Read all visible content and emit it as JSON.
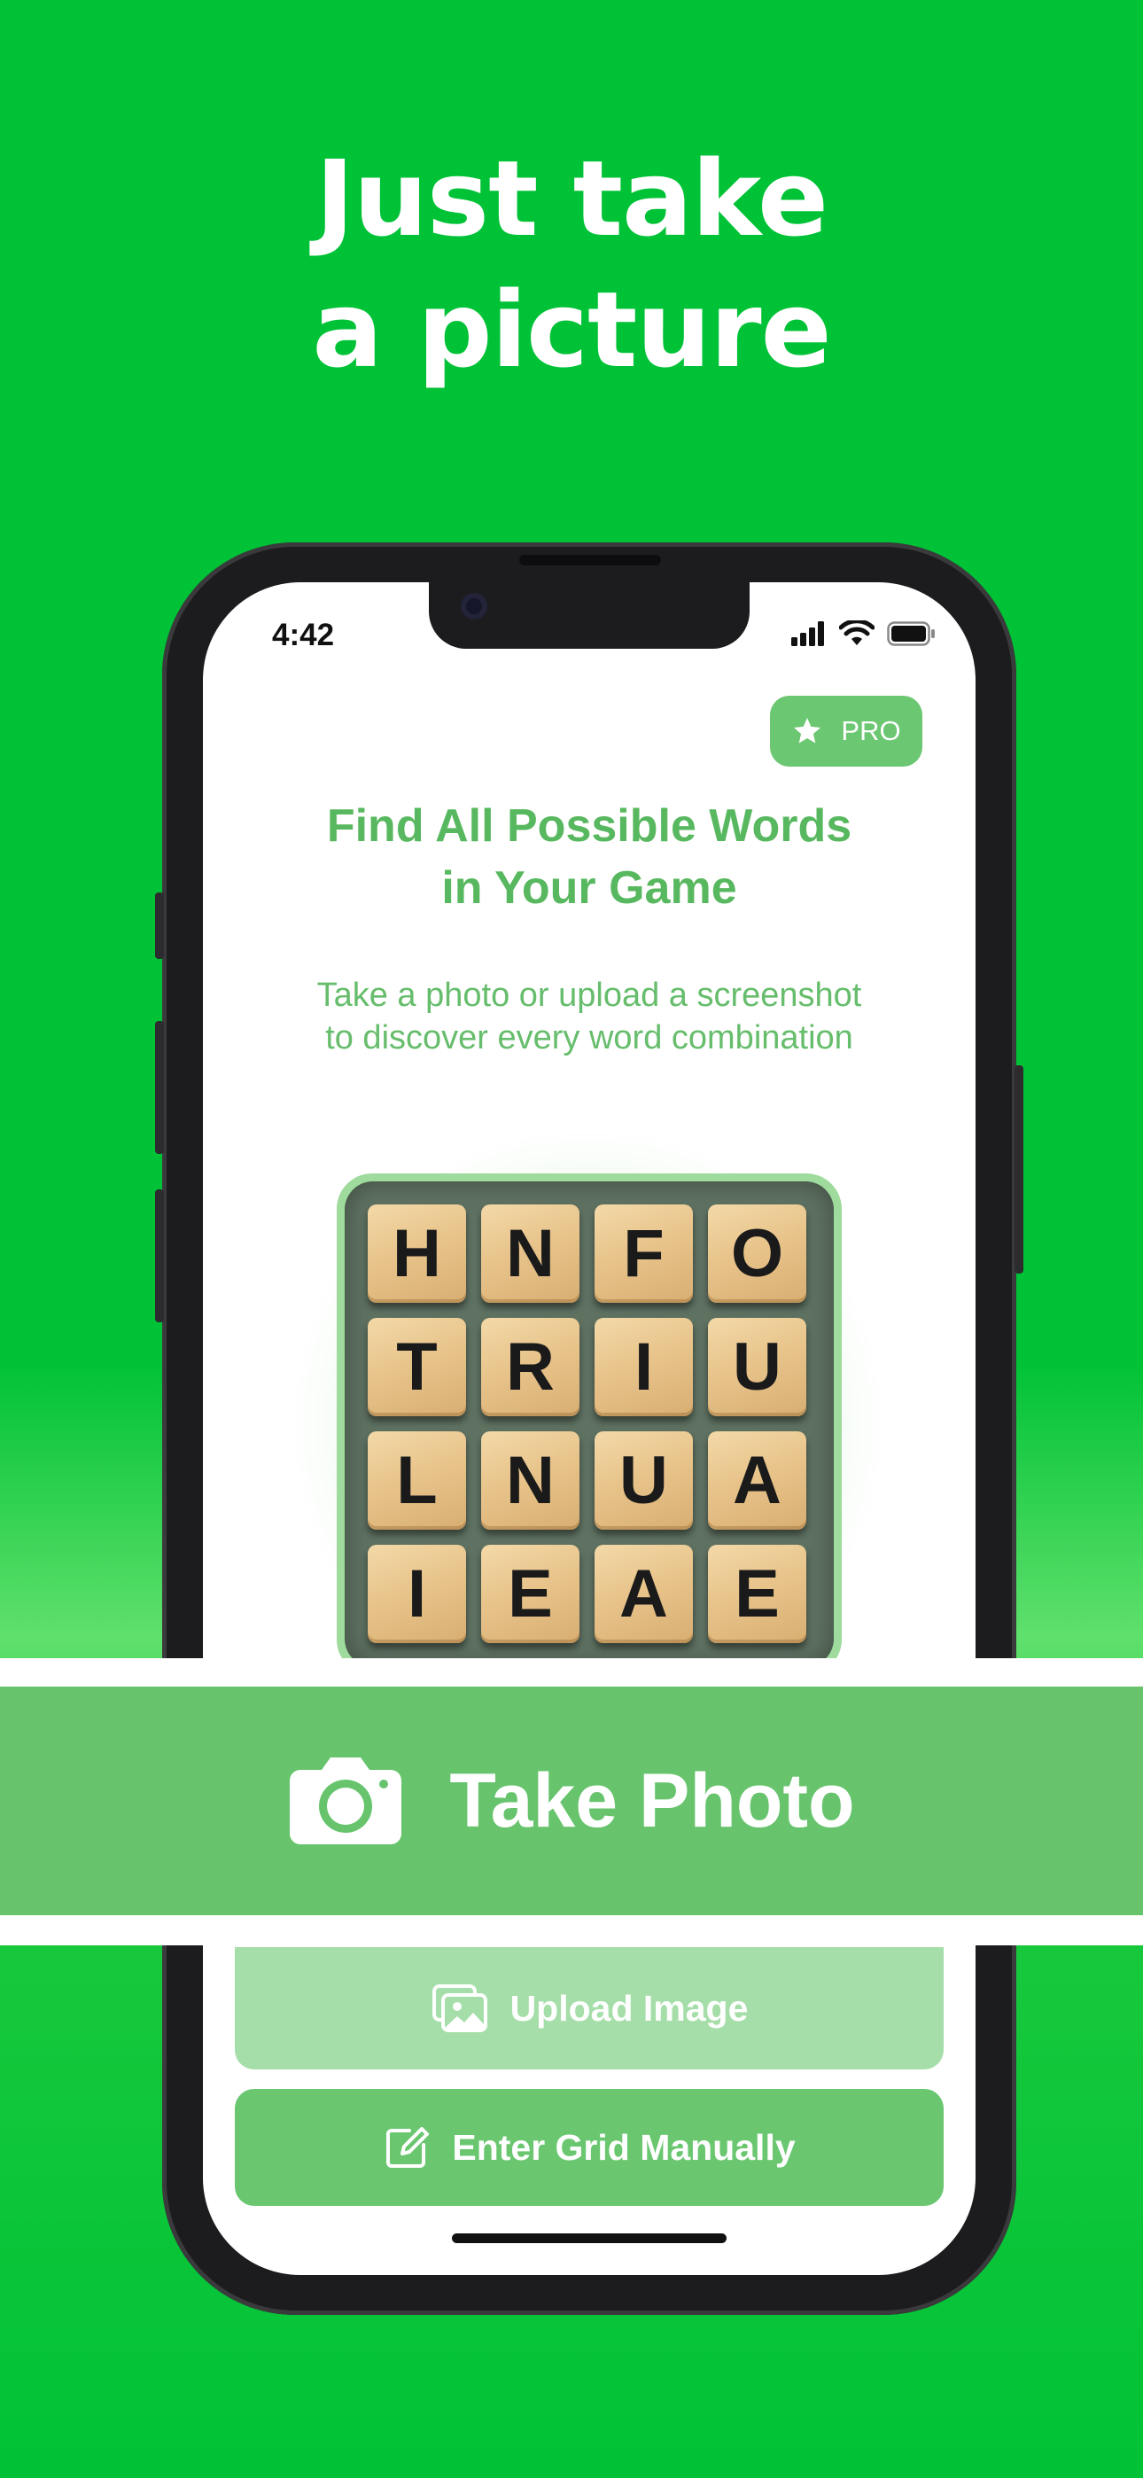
{
  "headline": {
    "line1": "Just take",
    "line2": "a picture"
  },
  "status_bar": {
    "time": "4:42"
  },
  "pro_button": {
    "label": "PRO",
    "icon": "star-icon"
  },
  "main": {
    "title_line1": "Find All Possible Words",
    "title_line2": "in Your Game",
    "subtitle_line1": "Take a photo or upload a screenshot",
    "subtitle_line2": "to discover every word combination"
  },
  "grid": {
    "rows": [
      [
        "H",
        "N",
        "F",
        "O"
      ],
      [
        "T",
        "R",
        "I",
        "U"
      ],
      [
        "L",
        "N",
        "U",
        "A"
      ],
      [
        "I",
        "E",
        "A",
        "E"
      ]
    ]
  },
  "actions": {
    "take_photo": {
      "label": "Take Photo",
      "icon": "camera-icon"
    },
    "upload_image": {
      "label": "Upload Image",
      "icon": "photos-icon"
    },
    "enter_manually": {
      "label": "Enter Grid Manually",
      "icon": "edit-icon"
    }
  },
  "colors": {
    "background": "#00c236",
    "accent": "#67c46d",
    "title_text": "#58b85f"
  }
}
